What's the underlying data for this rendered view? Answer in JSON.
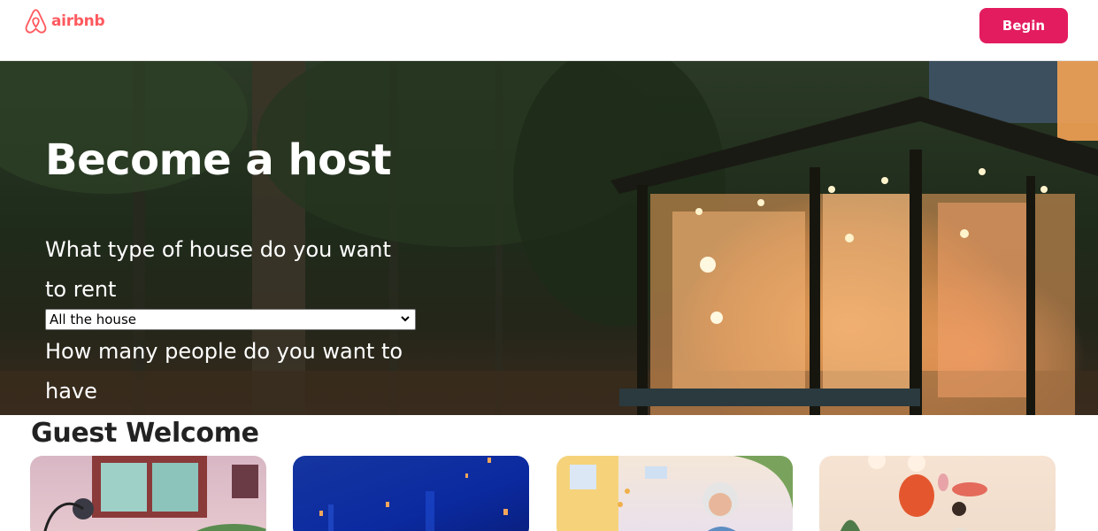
{
  "header": {
    "logo_text": "airbnb",
    "begin_label": "Begin",
    "brand_color": "#ff5a5f",
    "button_color": "#e31c5f"
  },
  "hero": {
    "title": "Become a host",
    "question_house": "What type of house do you want to rent",
    "house_select_value": "All the house",
    "question_people": "How many people do you want to have"
  },
  "guest": {
    "title": "Guest Welcome"
  },
  "icons": {
    "logo": "airbnb-belo-icon",
    "select": "chevron-down-icon"
  }
}
